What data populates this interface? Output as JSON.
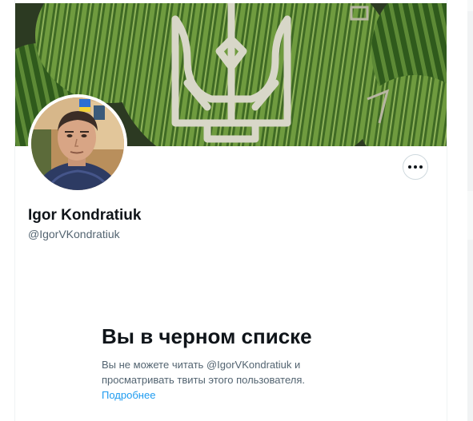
{
  "profile": {
    "display_name": "Igor Kondratiuk",
    "handle": "@IgorVKondratiuk",
    "banner_desc": "watermelon-trident-banner",
    "avatar_desc": "avatar-photo"
  },
  "more_button": {
    "icon": "more-dots-icon"
  },
  "blocked": {
    "title": "Вы в черном списке",
    "line1": "Вы не можете читать @IgorVKondratiuk и",
    "line2": "просматривать твиты этого пользователя.",
    "link": "Подробнее"
  },
  "colors": {
    "text_primary": "#0f1419",
    "text_secondary": "#536471",
    "link": "#1d9bf0",
    "border": "#cfd9de"
  }
}
